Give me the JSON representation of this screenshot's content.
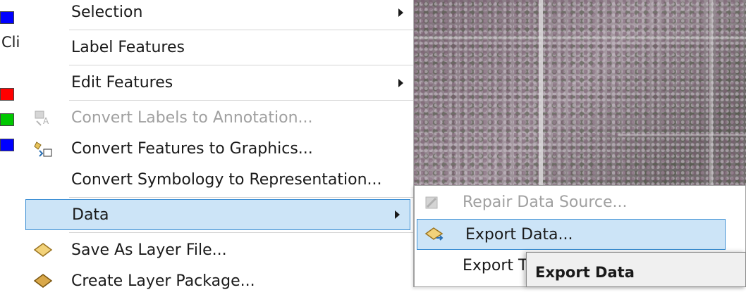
{
  "toc": {
    "partial_label": "Cli",
    "swatch_colors": [
      "#0000ff",
      "#ff0000",
      "#00c800",
      "#0000ff"
    ]
  },
  "menu": {
    "items": [
      {
        "label": "Selection",
        "has_submenu": true,
        "enabled": true
      },
      {
        "label": "Label Features",
        "has_submenu": false,
        "enabled": true
      },
      {
        "label": "Edit Features",
        "has_submenu": true,
        "enabled": true
      },
      {
        "label": "Convert Labels to Annotation...",
        "has_submenu": false,
        "enabled": false,
        "icon": "convert-labels-icon"
      },
      {
        "label": "Convert Features to Graphics...",
        "has_submenu": false,
        "enabled": true,
        "icon": "convert-graphics-icon"
      },
      {
        "label": "Convert Symbology to Representation...",
        "has_submenu": false,
        "enabled": true
      },
      {
        "label": "Data",
        "has_submenu": true,
        "enabled": true,
        "highlighted": true
      },
      {
        "label": "Save As Layer File...",
        "has_submenu": false,
        "enabled": true,
        "icon": "layer-file-icon"
      },
      {
        "label": "Create Layer Package...",
        "has_submenu": false,
        "enabled": true,
        "icon": "layer-package-icon"
      }
    ]
  },
  "submenu": {
    "items": [
      {
        "label": "Repair Data Source...",
        "enabled": false,
        "icon": "repair-icon"
      },
      {
        "label": "Export Data...",
        "enabled": true,
        "highlighted": true,
        "icon": "export-data-icon"
      },
      {
        "label": "Export To",
        "enabled": true
      }
    ]
  },
  "dialog": {
    "title": "Export Data"
  },
  "colors": {
    "highlight_bg": "#cce4f7",
    "highlight_border": "#3b8ed4",
    "disabled_text": "#a0a0a0"
  }
}
